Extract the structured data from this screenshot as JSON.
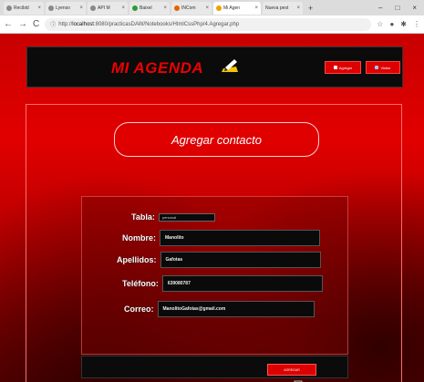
{
  "browser": {
    "tabs": [
      {
        "label": "Recibid",
        "active": false
      },
      {
        "label": "Lyenso",
        "active": false
      },
      {
        "label": "API M",
        "active": false
      },
      {
        "label": "Baixel",
        "active": false
      },
      {
        "label": "INCom",
        "active": false
      },
      {
        "label": "Mi Agen",
        "active": true
      },
      {
        "label": "Nueva pest",
        "active": false
      }
    ],
    "new_tab": "+",
    "url_prefix": "http://",
    "url_host": "localhost",
    "url_path": ":8080/practicasDAW/Notebooks/HtmlCssPhp/4.Agregar.php"
  },
  "header": {
    "brand": "MI AGENDA",
    "buttons": [
      {
        "label": "Agregar"
      },
      {
        "label": "Visitor"
      }
    ]
  },
  "main": {
    "title": "Agregar contacto",
    "form": {
      "tabla_label": "Tabla:",
      "tabla_value": "personal",
      "nombre_label": "Nombre:",
      "nombre_value": "Manolito",
      "apellidos_label": "Apellidos:",
      "apellidos_value": "Gafotas",
      "telefono_label": "Teléfono:",
      "telefono_value": "639080787",
      "correo_label": "Correo:",
      "correo_value": "ManolitoGafotas@gmail.com",
      "submit_label": "AGREGAR"
    }
  },
  "colors": {
    "accent": "#dd0000",
    "panel": "#0b0b0b"
  }
}
